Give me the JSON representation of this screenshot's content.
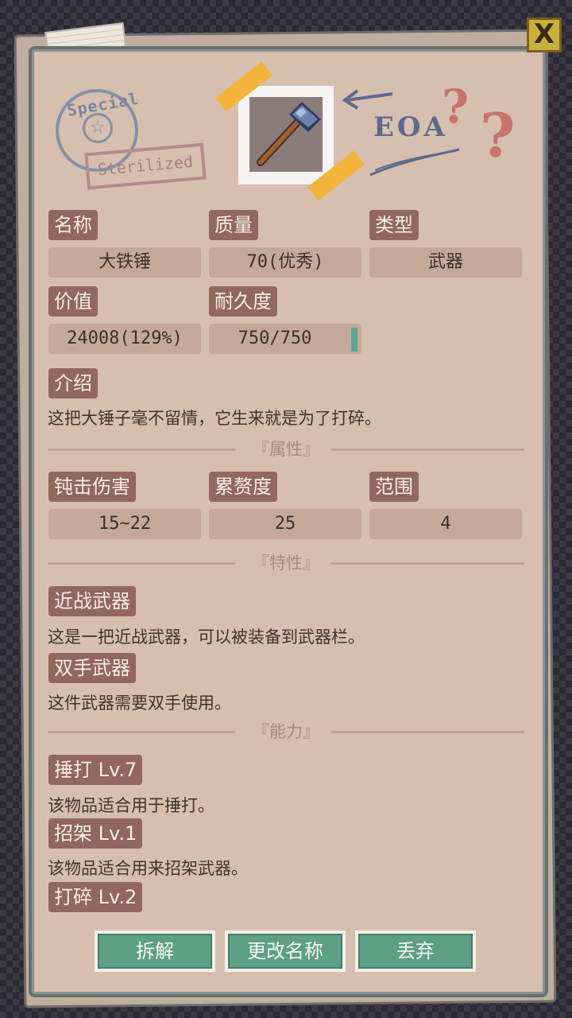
{
  "header": {
    "close_label": "X",
    "stamp_circle_text": "Special",
    "stamp_rect_text": "Sterilized",
    "eoa_text": "EOA"
  },
  "item": {
    "icon": "hammer-icon",
    "fields": {
      "name_label": "名称",
      "name_value": "大铁锤",
      "quality_label": "质量",
      "quality_value": "70(优秀)",
      "type_label": "类型",
      "type_value": "武器",
      "price_label": "价值",
      "price_value": "24008(129%)",
      "durability_label": "耐久度",
      "durability_value": "750/750",
      "durability_fraction": 1.0
    },
    "intro_label": "介绍",
    "intro_text": "这把大锤子毫不留情，它生来就是为了打碎。"
  },
  "attributes": {
    "section_title": "『属性』",
    "items": [
      {
        "label": "钝击伤害",
        "value": "15~22"
      },
      {
        "label": "累赘度",
        "value": "25"
      },
      {
        "label": "范围",
        "value": "4"
      }
    ]
  },
  "traits": {
    "section_title": "『特性』",
    "items": [
      {
        "label": "近战武器",
        "desc": "这是一把近战武器，可以被装备到武器栏。"
      },
      {
        "label": "双手武器",
        "desc": "这件武器需要双手使用。"
      }
    ]
  },
  "abilities": {
    "section_title": "『能力』",
    "items": [
      {
        "label": "捶打 Lv.7",
        "desc": "该物品适合用于捶打。"
      },
      {
        "label": "招架 Lv.1",
        "desc": "该物品适合用来招架武器。"
      },
      {
        "label": "打碎 Lv.2",
        "desc": ""
      }
    ]
  },
  "buttons": {
    "dismantle": "拆解",
    "rename": "更改名称",
    "discard": "丢弃"
  },
  "colors": {
    "panel": "#d6bfae",
    "label_bg": "#91675f",
    "value_bg": "#c4a999",
    "button": "#5e9f87",
    "tape": "#f2b43b"
  }
}
